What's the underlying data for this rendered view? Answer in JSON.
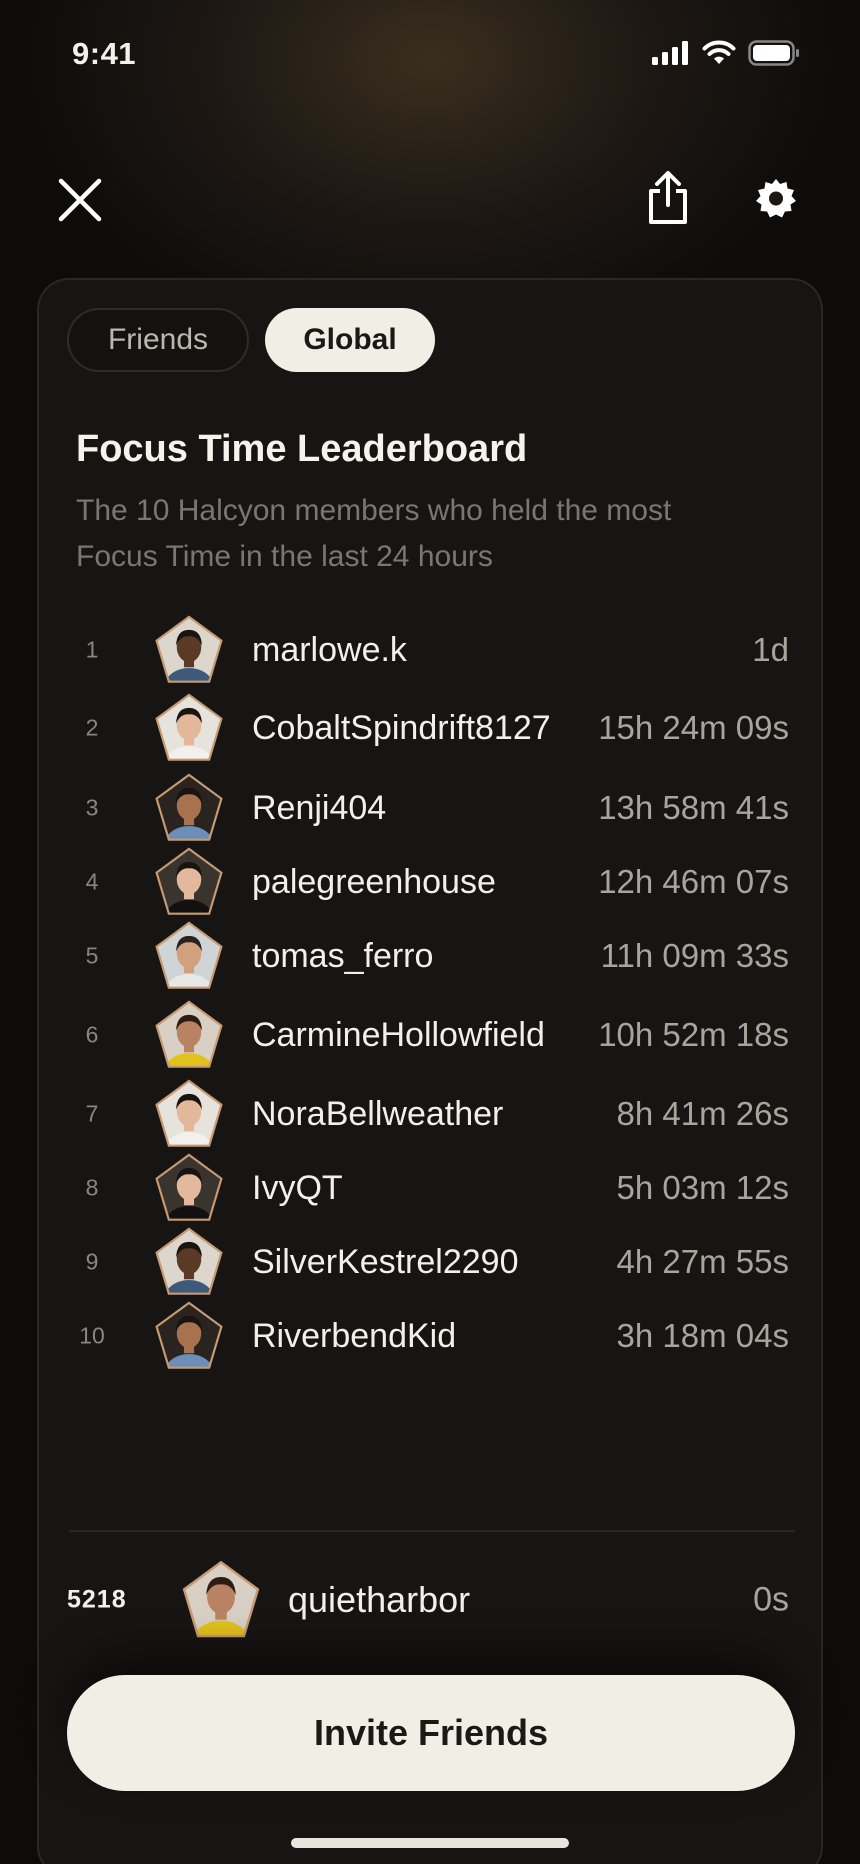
{
  "status_bar": {
    "time": "9:41"
  },
  "tabs": [
    {
      "label": "Friends",
      "active": false
    },
    {
      "label": "Global",
      "active": true
    }
  ],
  "leaderboard": {
    "title": "Focus Time Leaderboard",
    "subtitle": "The 10 Halcyon members who held the most Focus Time in the last 24 hours",
    "entries": [
      {
        "rank": "1",
        "name": "marlowe.k",
        "time": "1d",
        "avatar_bg": "#dcd6cc",
        "skin": "#5a3a24",
        "shirt": "#3d5a7a",
        "hair": "#1a1411",
        "frame": "light"
      },
      {
        "rank": "2",
        "name": "CobaltSpindrift8127",
        "time": "15h 24m 09s",
        "avatar_bg": "#e6e2dc",
        "skin": "#e2b79a",
        "shirt": "#f2f0ec",
        "hair": "#1a1411",
        "frame": "light"
      },
      {
        "rank": "3",
        "name": "Renji404",
        "time": "13h 58m 41s",
        "avatar_bg": "#2a2420",
        "skin": "#a9724e",
        "shirt": "#6b8fb8",
        "hair": "#1a1411",
        "frame": "dark"
      },
      {
        "rank": "4",
        "name": "palegreenhouse",
        "time": "12h 46m 07s",
        "avatar_bg": "#3a342f",
        "skin": "#e3b89c",
        "shirt": "#121010",
        "hair": "#1a1411",
        "frame": "dark"
      },
      {
        "rank": "5",
        "name": "tomas_ferro",
        "time": "11h 09m 33s",
        "avatar_bg": "#cfd4d6",
        "skin": "#d2a07c",
        "shirt": "#e8e8e6",
        "hair": "#2a2220",
        "frame": "light"
      },
      {
        "rank": "6",
        "name": "CarmineHollowfield",
        "time": "10h 52m 18s",
        "avatar_bg": "#d8d0c4",
        "skin": "#b98363",
        "shirt": "#e2c21e",
        "hair": "#2c1c14",
        "frame": "light"
      },
      {
        "rank": "7",
        "name": "NoraBellweather",
        "time": "8h 41m 26s",
        "avatar_bg": "#e6e2dc",
        "skin": "#e2b79a",
        "shirt": "#f2f0ec",
        "hair": "#1a1411",
        "frame": "light"
      },
      {
        "rank": "8",
        "name": "IvyQT",
        "time": "5h 03m 12s",
        "avatar_bg": "#3a342f",
        "skin": "#e3b89c",
        "shirt": "#121010",
        "hair": "#1a1411",
        "frame": "dark"
      },
      {
        "rank": "9",
        "name": "SilverKestrel2290",
        "time": "4h 27m 55s",
        "avatar_bg": "#dcd6cc",
        "skin": "#5a3a24",
        "shirt": "#3d5a7a",
        "hair": "#1a1411",
        "frame": "light"
      },
      {
        "rank": "10",
        "name": "RiverbendKid",
        "time": "3h 18m 04s",
        "avatar_bg": "#2a2420",
        "skin": "#a9724e",
        "shirt": "#6b8fb8",
        "hair": "#1a1411",
        "frame": "dark"
      }
    ],
    "current_user": {
      "rank": "5218",
      "name": "quietharbor",
      "time": "0s",
      "avatar_bg": "#d8d0c4",
      "skin": "#b98363",
      "shirt": "#e2c21e",
      "hair": "#2c1c14"
    }
  },
  "invite_button": {
    "label": "Invite Friends"
  },
  "colors": {
    "frame": "#c79a72",
    "accent_light": "#f1eee6"
  }
}
